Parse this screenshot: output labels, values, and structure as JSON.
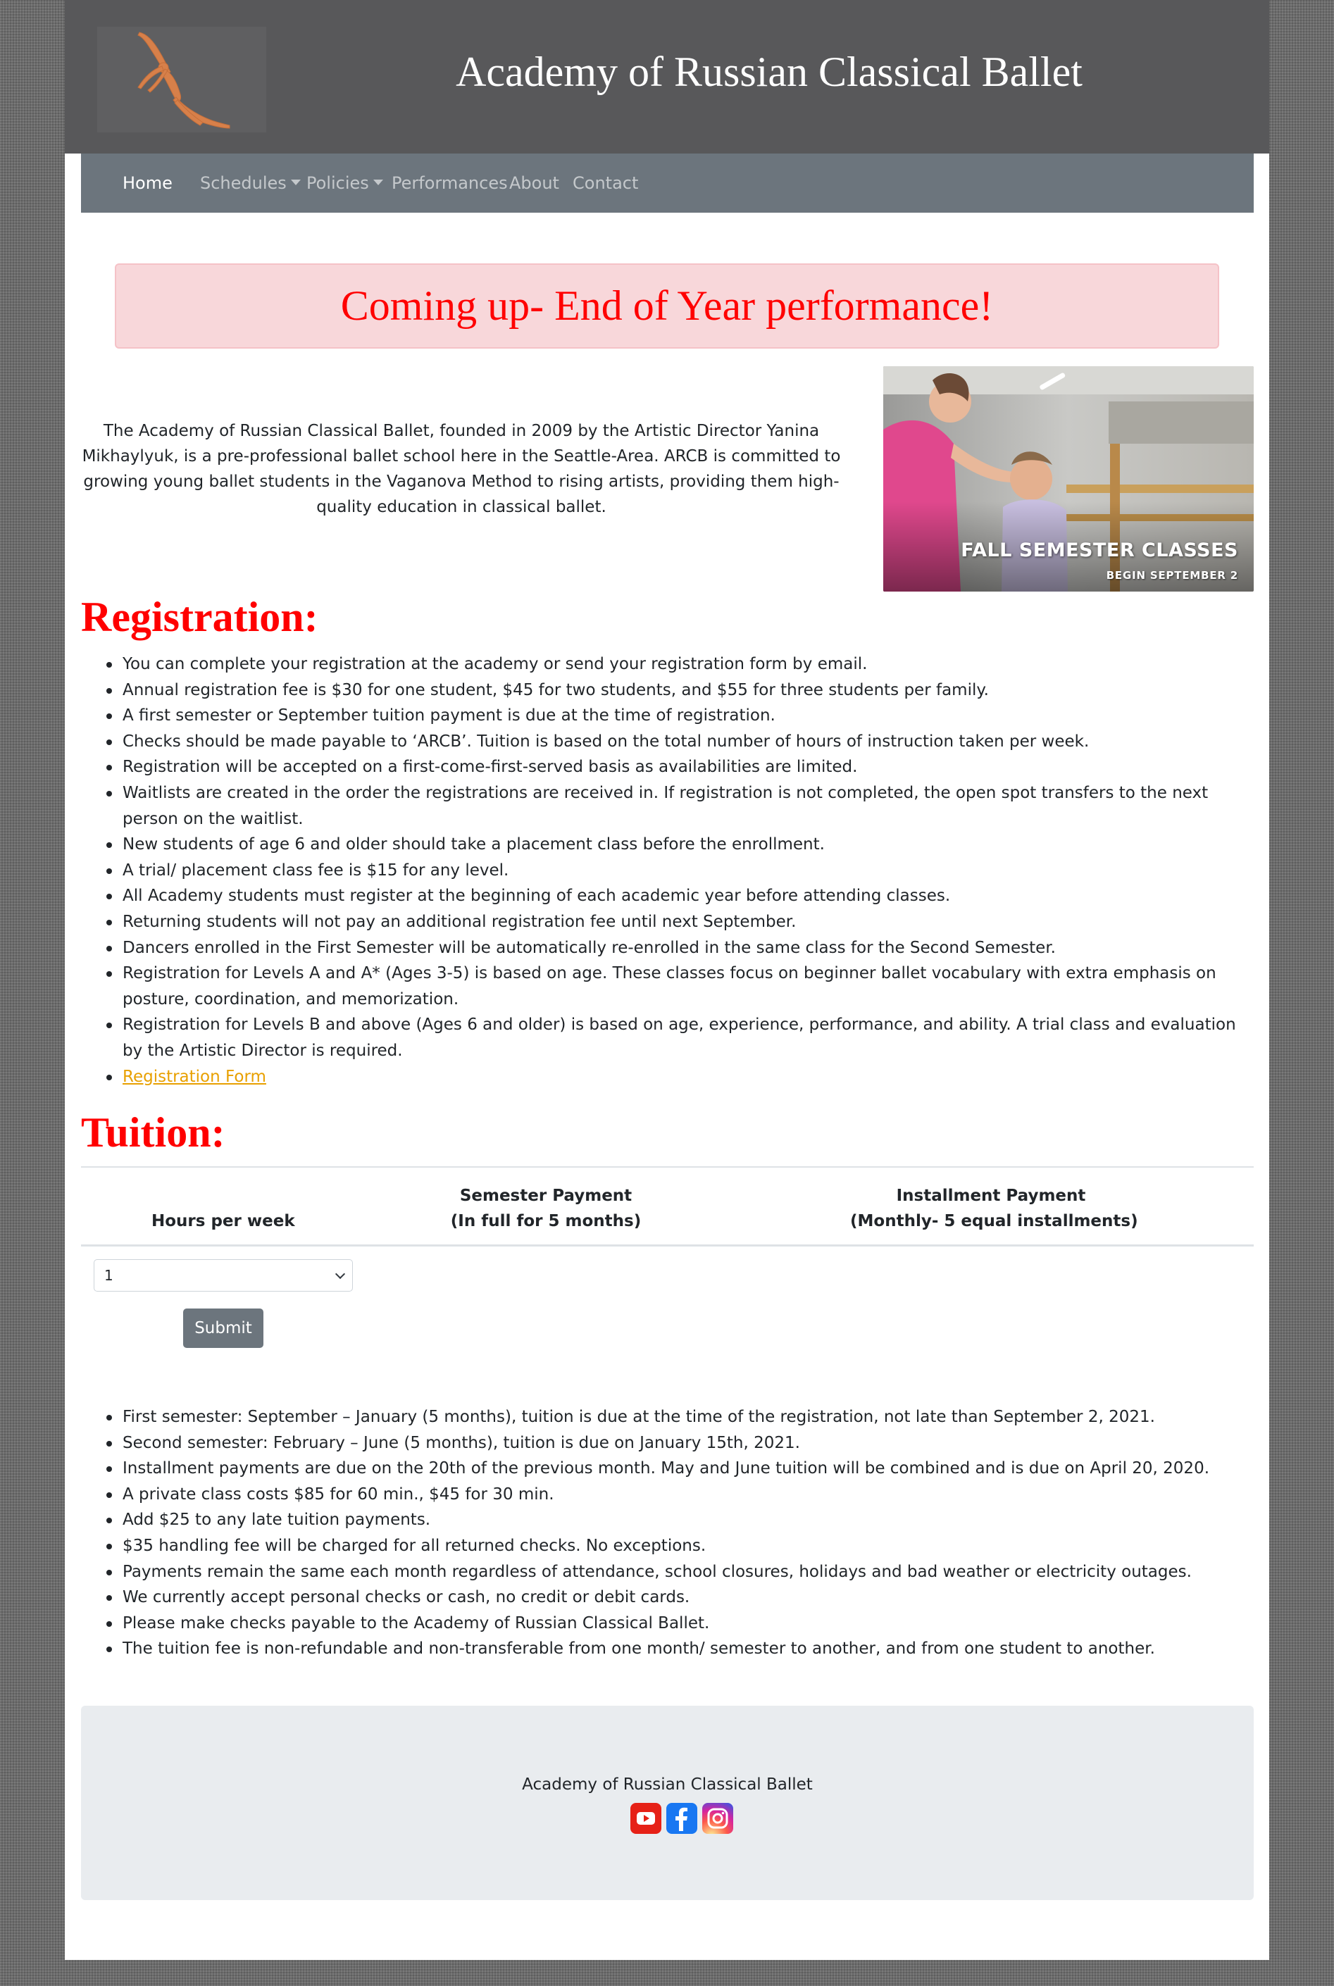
{
  "header": {
    "site_title": "Academy of Russian Classical Ballet"
  },
  "nav": {
    "home": "Home",
    "schedules": "Schedules",
    "policies": "Policies",
    "performances": "Performances",
    "about": "About",
    "contact": "Contact"
  },
  "alert": {
    "text": "Coming up- End of Year performance!"
  },
  "intro": {
    "text": "The Academy of Russian Classical Ballet, founded in 2009 by the Artistic Director Yanina Mikhaylyuk, is a pre-professional ballet school here in the Seattle-Area. ARCB is committed to growing young ballet students in the Vaganova Method to rising artists, providing them high-quality education in classical ballet."
  },
  "promo": {
    "title": "FALL SEMESTER CLASSES",
    "subtitle": "BEGIN SEPTEMBER 2"
  },
  "registration": {
    "heading": "Registration:",
    "items": [
      "You can complete your registration at the academy or send your registration form by email.",
      "Annual registration fee is $30 for one student, $45 for two students, and $55 for three students per family.",
      "A first semester or September tuition payment is due at the time of registration.",
      "Checks should be made payable to ‘ARCB’. Tuition is based on the total number of hours of instruction taken per week.",
      "Registration will be accepted on a first-come-first-served basis as availabilities are limited.",
      "Waitlists are created in the order the registrations are received in. If registration is not completed, the open spot transfers to the next person on the waitlist.",
      "New students of age 6 and older should take a placement class before the enrollment.",
      "A trial/ placement class fee is $15 for any level.",
      "All Academy students must register at the beginning of each academic year before attending classes.",
      "Returning students will not pay an additional registration fee until next September.",
      "Dancers enrolled in the First Semester will be automatically re-enrolled in the same class for the Second Semester.",
      "Registration for Levels A and A* (Ages 3-5) is based on age. These classes focus on beginner ballet vocabulary with extra emphasis on posture, coordination, and memorization.",
      "Registration for Levels B and above (Ages 6 and older) is based on age, experience, performance, and ability. A trial class and evaluation by the Artistic Director is required."
    ],
    "form_link": "Registration Form"
  },
  "tuition": {
    "heading": "Tuition:",
    "table": {
      "col1": "Hours per week",
      "col2_line1": "Semester Payment",
      "col2_line2": "(In full for 5 months)",
      "col3_line1": "Installment Payment",
      "col3_line2": "(Monthly- 5 equal installments)"
    },
    "select_value": "1",
    "submit_label": "Submit",
    "items": [
      "First semester: September – January (5 months), tuition is due at the time of the registration, not late than September 2, 2021.",
      "Second semester: February – June (5 months), tuition is due on January 15th, 2021.",
      "Installment payments are due on the 20th of the previous month. May and June tuition will be combined and is due on April 20, 2020.",
      "A private class costs $85 for 60 min., $45 for 30 min.",
      "Add $25 to any late tuition payments.",
      "$35 handling fee will be charged for all returned checks. No exceptions.",
      "Payments remain the same each month regardless of attendance, school closures, holidays and bad weather or electricity outages.",
      "We currently accept personal checks or cash, no credit or debit cards.",
      "Please make checks payable to the Academy of Russian Classical Ballet.",
      "The tuition fee is non-refundable and non-transferable from one month/ semester to another, and from one student to another."
    ]
  },
  "footer": {
    "name": "Academy of Russian Classical Ballet",
    "social": [
      "youtube-icon",
      "facebook-icon",
      "instagram-icon"
    ]
  },
  "colors": {
    "header_bg": "#58585a",
    "nav_bg": "#6c757d",
    "accent_red": "#ff0000",
    "alert_bg": "#f8d7da",
    "link": "#e8a000",
    "footer_bg": "#e9ecef"
  }
}
